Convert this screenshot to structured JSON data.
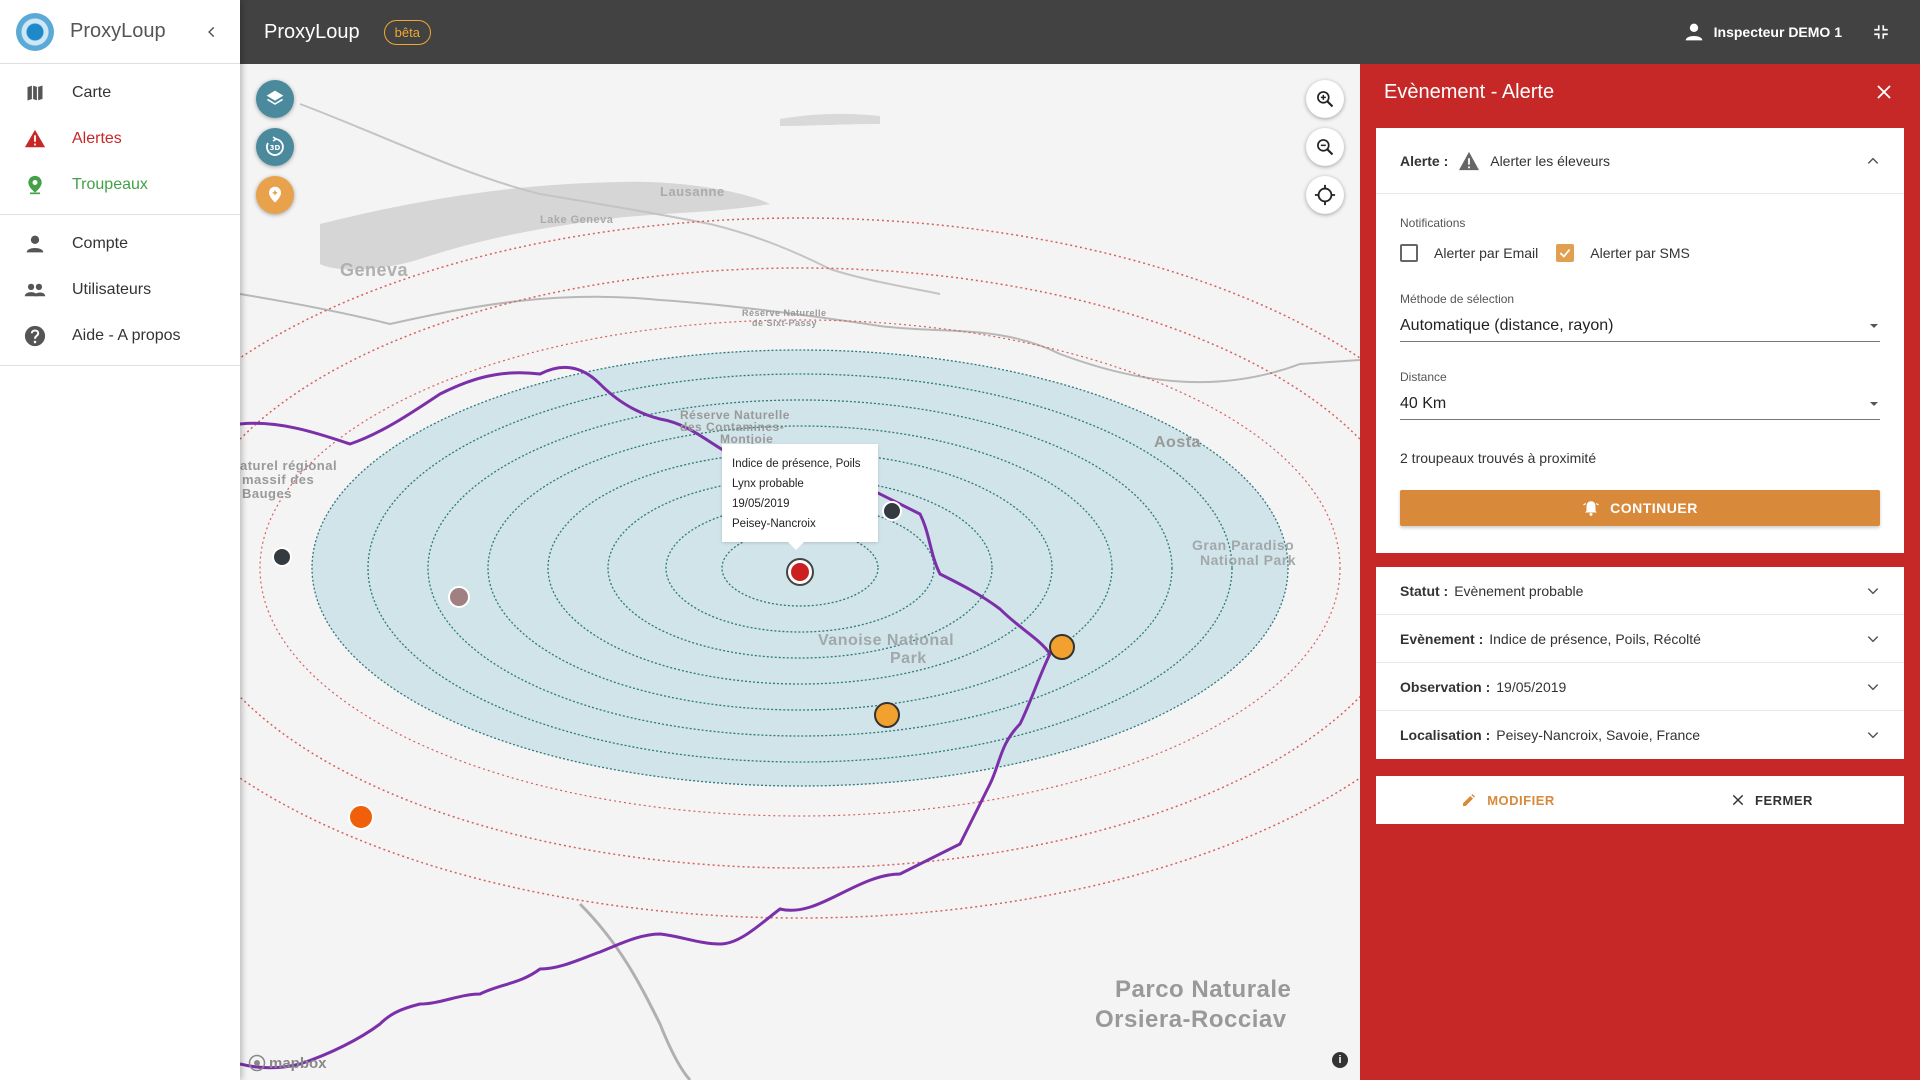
{
  "sidebar": {
    "app_name": "ProxyLoup",
    "primary": [
      {
        "label": "Carte",
        "icon": "map-icon"
      },
      {
        "label": "Alertes",
        "icon": "warning-icon"
      },
      {
        "label": "Troupeaux",
        "icon": "location-pin-icon"
      }
    ],
    "secondary": [
      {
        "label": "Compte",
        "icon": "person-icon"
      },
      {
        "label": "Utilisateurs",
        "icon": "people-icon"
      },
      {
        "label": "Aide - A propos",
        "icon": "help-icon"
      }
    ]
  },
  "topbar": {
    "title": "ProxyLoup",
    "badge": "bêta",
    "user": "Inspecteur DEMO 1"
  },
  "map": {
    "tooltip": {
      "line1": "Indice de présence, Poils",
      "line2": "Lynx probable",
      "line3": "19/05/2019",
      "line4": "Peisey-Nancroix"
    },
    "places": {
      "geneva": "Geneva",
      "lausanne": "Lausanne",
      "lake": "Lake Geneva",
      "aosta": "Aosta",
      "vanoise1": "Vanoise National",
      "vanoise2": "Park",
      "gran1": "Gran Paradiso",
      "gran2": "National Park",
      "parco1": "Parco Naturale",
      "parco2": "Orsiera-Rocciav",
      "bauges1": "aturel régional",
      "bauges2": "massif des",
      "bauges3": "Bauges",
      "reserve1": "Réserve Naturelle",
      "reserve2": "des Contamines-",
      "reserve3": "Montjoie",
      "sixt1": "Réserve Naturelle",
      "sixt2": "de Sixt-Passy"
    },
    "attribution": "mapbox"
  },
  "panel": {
    "title": "Evènement - Alerte",
    "alert": {
      "label": "Alerte :",
      "value": "Alerter les éleveurs",
      "notifications_label": "Notifications",
      "email_label": "Alerter par Email",
      "email_checked": false,
      "sms_label": "Alerter par SMS",
      "sms_checked": true,
      "method_label": "Méthode de sélection",
      "method_value": "Automatique (distance, rayon)",
      "distance_label": "Distance",
      "distance_value": "40 Km",
      "found_text": "2 troupeaux trouvés à proximité",
      "continue_label": "CONTINUER"
    },
    "info_rows": [
      {
        "label": "Statut :",
        "value": "Evènement probable"
      },
      {
        "label": "Evènement :",
        "value": "Indice de présence, Poils, Récolté"
      },
      {
        "label": "Observation :",
        "value": "19/05/2019"
      },
      {
        "label": "Localisation :",
        "value": "Peisey-Nancroix, Savoie, France"
      }
    ],
    "actions": {
      "modify": "MODIFIER",
      "close": "FERMER"
    }
  },
  "colors": {
    "panel_red": "#c62828",
    "accent_orange": "#d8893a",
    "topbar": "#424242",
    "herd_green": "#43a047"
  }
}
